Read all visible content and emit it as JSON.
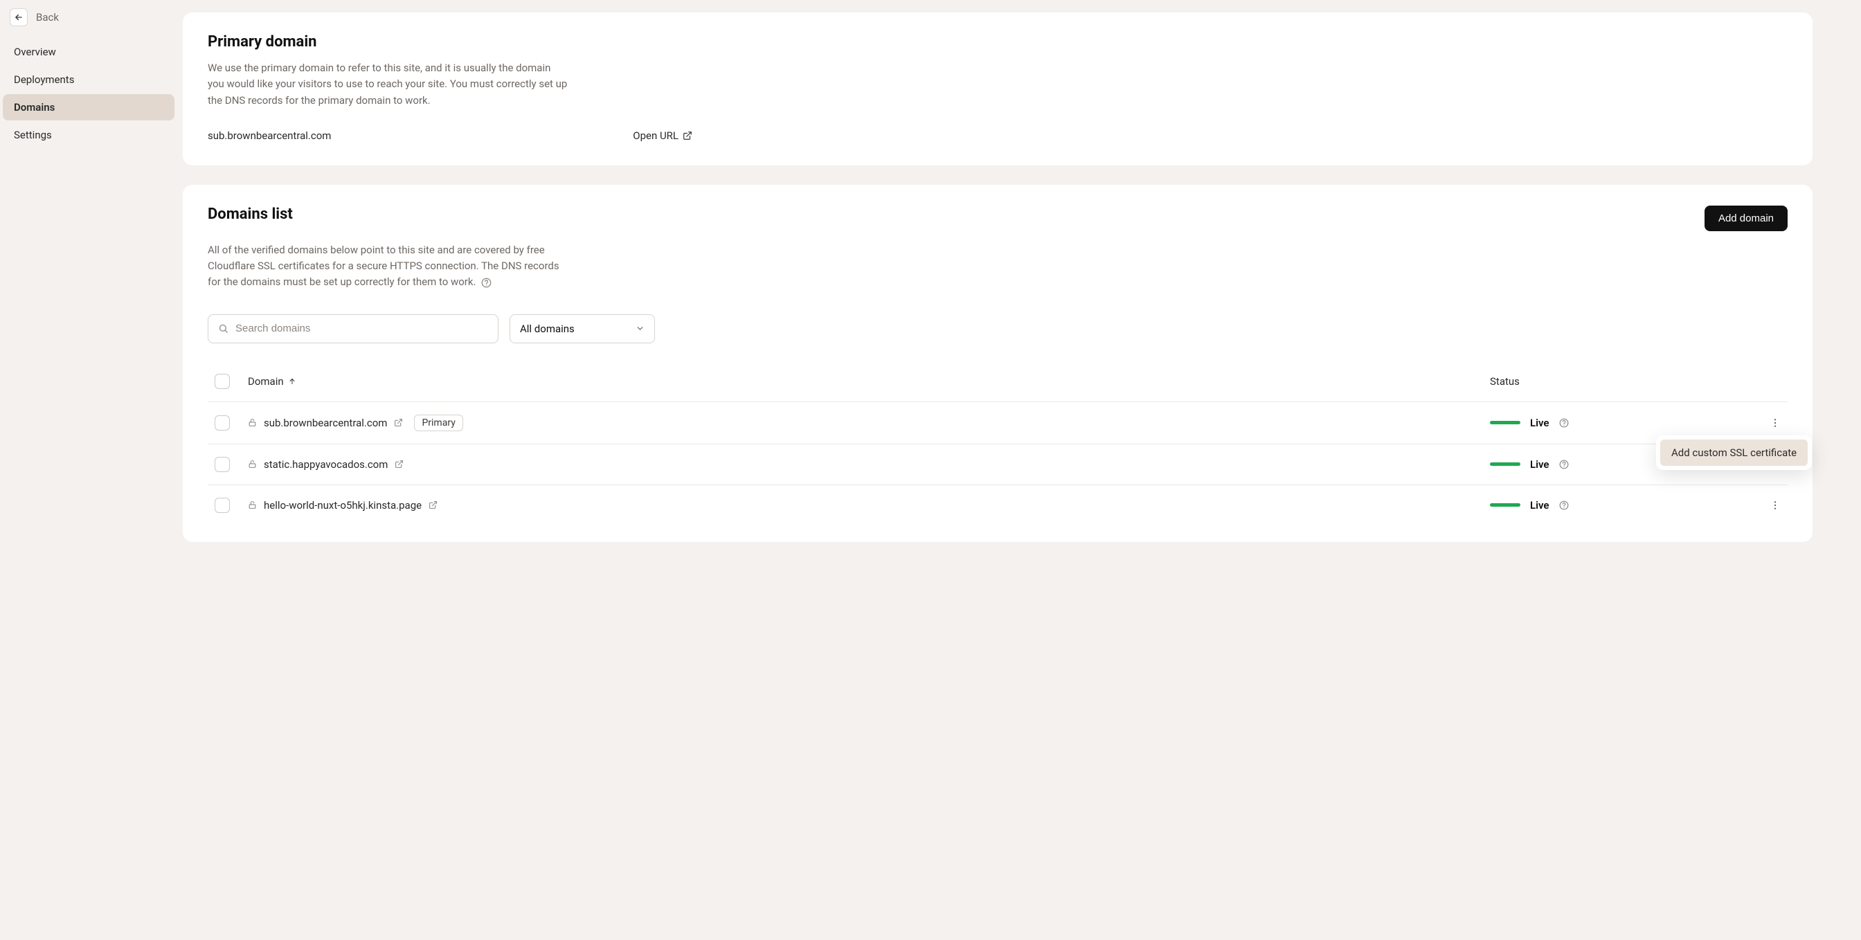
{
  "back": {
    "label": "Back"
  },
  "nav": {
    "items": [
      {
        "label": "Overview"
      },
      {
        "label": "Deployments"
      },
      {
        "label": "Domains"
      },
      {
        "label": "Settings"
      }
    ]
  },
  "primary": {
    "title": "Primary domain",
    "desc": "We use the primary domain to refer to this site, and it is usually the domain you would like your visitors to use to reach your site. You must correctly set up the DNS records for the primary domain to work.",
    "domain": "sub.brownbearcentral.com",
    "open_url_label": "Open URL"
  },
  "list": {
    "title": "Domains list",
    "desc": "All of the verified domains below point to this site and are covered by free Cloudflare SSL certificates for a secure HTTPS connection. The DNS records for the domains must be set up correctly for them to work.",
    "add_button": "Add domain",
    "search_placeholder": "Search domains",
    "filter_selected": "All domains",
    "columns": {
      "domain": "Domain",
      "status": "Status"
    },
    "rows": [
      {
        "domain": "sub.brownbearcentral.com",
        "primary_badge": "Primary",
        "status": "Live",
        "show_menu": true
      },
      {
        "domain": "static.happyavocados.com",
        "status": "Live",
        "show_menu": false
      },
      {
        "domain": "hello-world-nuxt-o5hkj.kinsta.page",
        "status": "Live",
        "show_menu": true
      }
    ]
  },
  "context_menu": {
    "item": "Add custom SSL certificate"
  }
}
